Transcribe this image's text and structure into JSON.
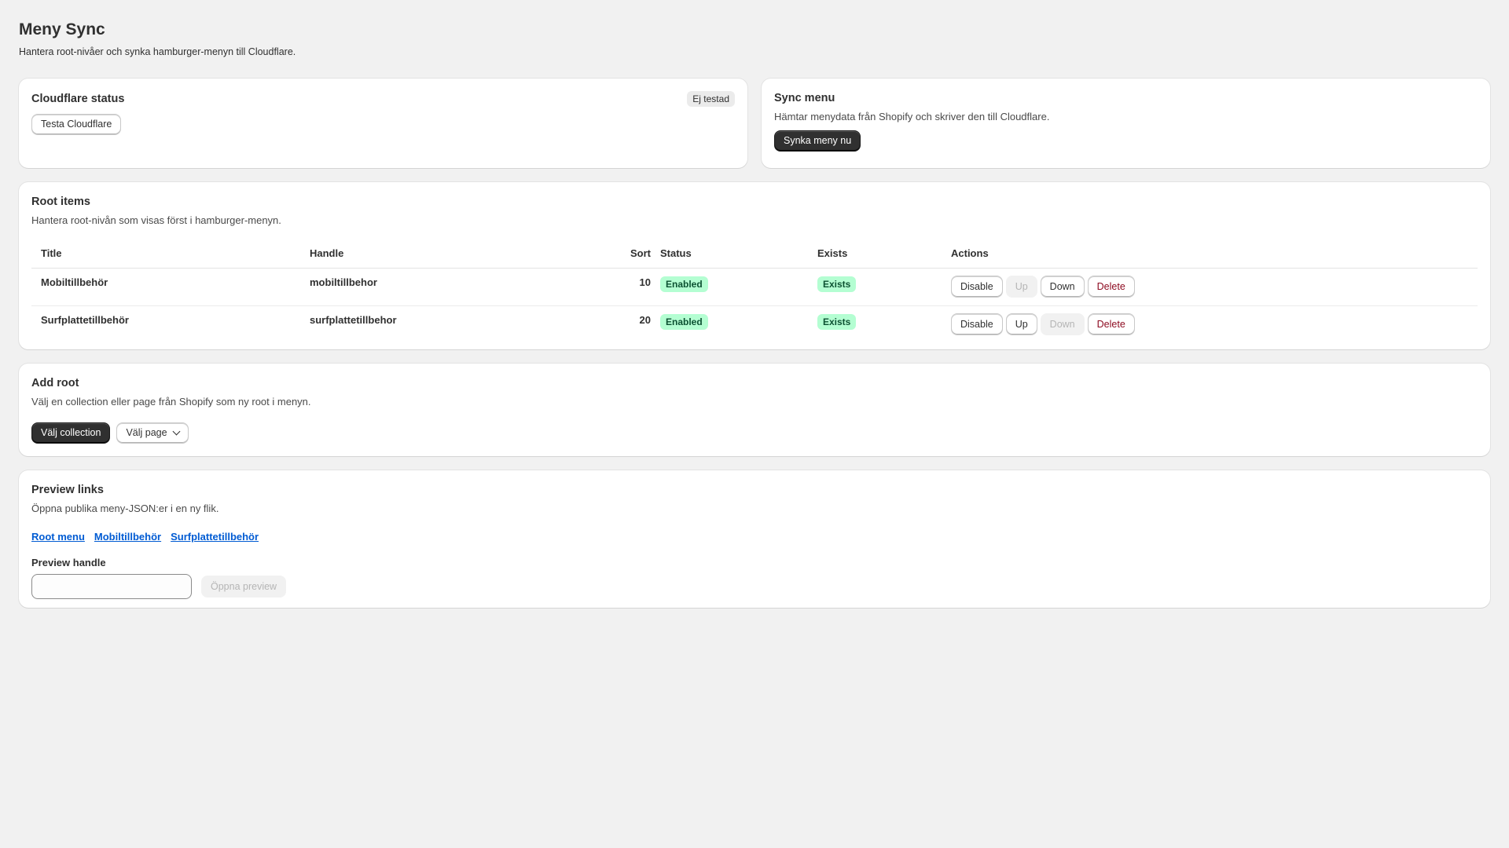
{
  "page": {
    "title": "Meny Sync",
    "subtitle": "Hantera root-nivåer och synka hamburger-menyn till Cloudflare."
  },
  "cloudflare": {
    "title": "Cloudflare status",
    "badge": "Ej testad",
    "test_button": "Testa Cloudflare"
  },
  "sync": {
    "title": "Sync menu",
    "description": "Hämtar menydata från Shopify och skriver den till Cloudflare.",
    "sync_button": "Synka meny nu"
  },
  "root_items": {
    "title": "Root items",
    "description": "Hantera root-nivån som visas först i hamburger-menyn.",
    "columns": {
      "title": "Title",
      "handle": "Handle",
      "sort": "Sort",
      "status": "Status",
      "exists": "Exists",
      "actions": "Actions"
    },
    "rows": [
      {
        "title": "Mobiltillbehör",
        "handle": "mobiltillbehor",
        "sort": "10",
        "status": "Enabled",
        "exists": "Exists",
        "disable": "Disable",
        "up": "Up",
        "down": "Down",
        "delete": "Delete"
      },
      {
        "title": "Surfplattetillbehör",
        "handle": "surfplattetillbehor",
        "sort": "20",
        "status": "Enabled",
        "exists": "Exists",
        "disable": "Disable",
        "up": "Up",
        "down": "Down",
        "delete": "Delete"
      }
    ]
  },
  "add_root": {
    "title": "Add root",
    "description": "Välj en collection eller page från Shopify som ny root i menyn.",
    "collection_button": "Välj collection",
    "page_button": "Välj page"
  },
  "preview": {
    "title": "Preview links",
    "description": "Öppna publika meny-JSON:er i en ny flik.",
    "links": [
      "Root menu",
      "Mobiltillbehör",
      "Surfplattetillbehör"
    ],
    "handle_label": "Preview handle",
    "handle_value": "",
    "open_button": "Öppna preview"
  },
  "colors": {
    "background": "#f1f1f1",
    "card": "#ffffff",
    "primary_button": "#303030",
    "success_badge": "#b4fed2",
    "critical_text": "#8e0b21",
    "link": "#005bd3"
  }
}
